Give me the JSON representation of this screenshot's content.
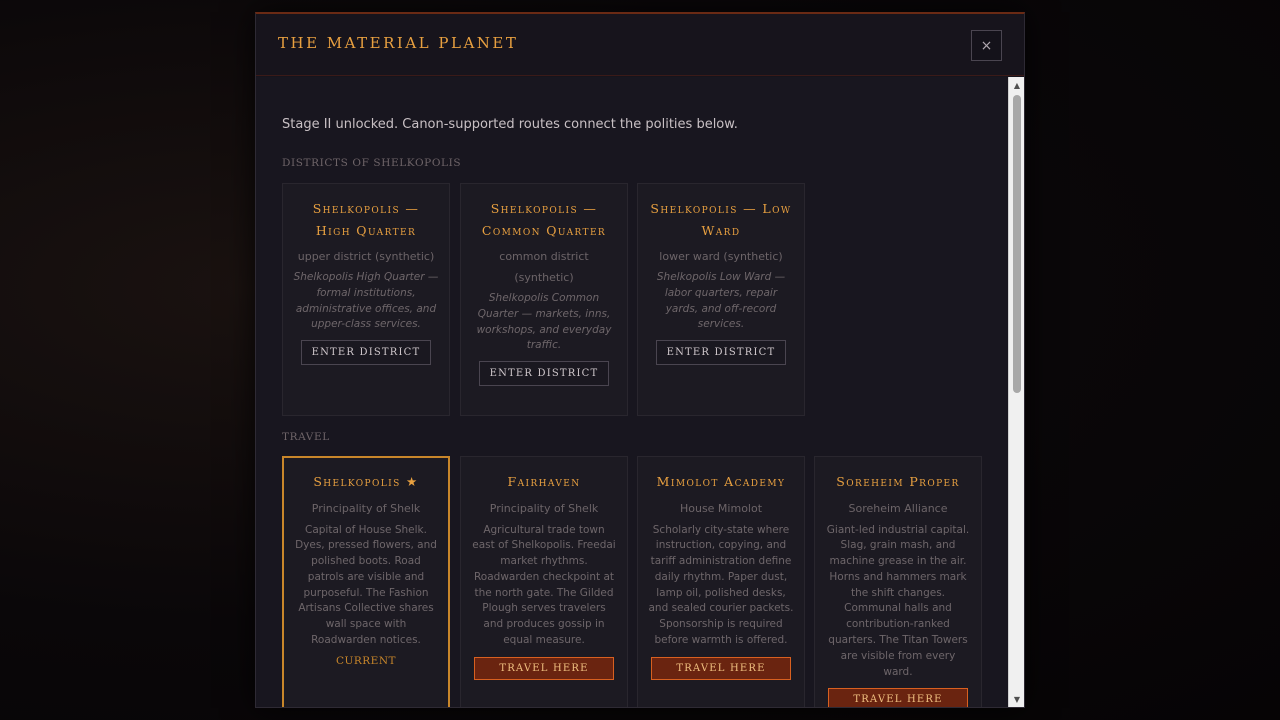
{
  "modal": {
    "title": "The Material Planet",
    "close_label": "×"
  },
  "intro": "Stage II unlocked. Canon-supported routes connect the polities below.",
  "sections": {
    "districts_label": "Districts of Shelkopolis",
    "travel_label": "Travel"
  },
  "districts": [
    {
      "title": "Shelkopolis — High Quarter",
      "subtitle": "upper district (synthetic)",
      "description": "Shelkopolis High Quarter — formal institutions, administrative offices, and upper-class services.",
      "button": "Enter District"
    },
    {
      "title": "Shelkopolis — Common Quarter",
      "subtitle": "common district (synthetic)",
      "description": "Shelkopolis Common Quarter — markets, inns, workshops, and everyday traffic.",
      "button": "Enter District"
    },
    {
      "title": "Shelkopolis — Low Ward",
      "subtitle": "lower ward (synthetic)",
      "description": "Shelkopolis Low Ward — labor quarters, repair yards, and off-record services.",
      "button": "Enter District"
    }
  ],
  "destinations": [
    {
      "title": "Shelkopolis ★",
      "polity": "Principality of Shelk",
      "description": "Capital of House Shelk. Dyes, pressed flowers, and polished boots. Road patrols are visible and purposeful. The Fashion Artisans Collective shares wall space with Roadwarden notices.",
      "status": "Current"
    },
    {
      "title": "Fairhaven",
      "polity": "Principality of Shelk",
      "description": "Agricultural trade town east of Shelkopolis. Freedai market rhythms. Roadwarden checkpoint at the north gate. The Gilded Plough serves travelers and produces gossip in equal measure.",
      "button": "Travel Here"
    },
    {
      "title": "Mimolot Academy",
      "polity": "House Mimolot",
      "description": "Scholarly city-state where instruction, copying, and tariff administration define daily rhythm. Paper dust, lamp oil, polished desks, and sealed courier packets. Sponsorship is required before warmth is offered.",
      "button": "Travel Here"
    },
    {
      "title": "Soreheim Proper",
      "polity": "Soreheim Alliance",
      "description": "Giant-led industrial capital. Slag, grain mash, and machine grease in the air. Horns and hammers mark the shift changes. Communal halls and contribution-ranked quarters. The Titan Towers are visible from every ward.",
      "button": "Travel Here"
    }
  ],
  "colors": {
    "accent": "#e8a040",
    "travel_button": "#6a2410",
    "current_border": "#c8862a"
  }
}
